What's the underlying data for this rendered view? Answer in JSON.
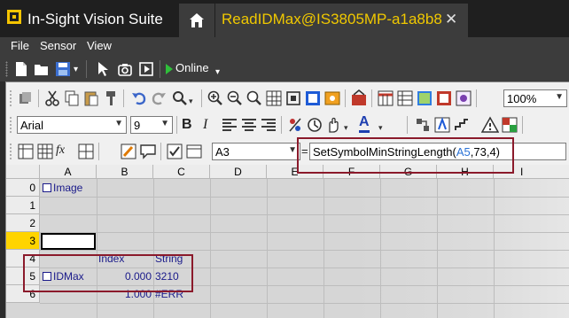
{
  "titlebar": {
    "app_title": "In-Sight Vision Suite",
    "active_tab": "ReadIDMax@IS3805MP-a1a8b8",
    "close_glyph": "✕"
  },
  "menu": {
    "items": [
      "File",
      "Sensor",
      "View"
    ]
  },
  "toolbar_top": {
    "online_label": "Online"
  },
  "toolbar_zoom": {
    "zoom_value": "100%"
  },
  "toolbar_font": {
    "font_name": "Arial",
    "font_size": "9"
  },
  "formula_bar": {
    "cell_ref": "A3",
    "equals": "=",
    "formula_prefix": "SetSymbolMinStringLength(",
    "formula_ref": "A5",
    "formula_suffix": ",73,4)"
  },
  "grid": {
    "columns": [
      "A",
      "B",
      "C",
      "D",
      "E",
      "F",
      "G",
      "H",
      "I"
    ],
    "rows": [
      "0",
      "1",
      "2",
      "3",
      "4",
      "5",
      "6"
    ],
    "selected_row": "3",
    "cells": {
      "a0": "Image",
      "b4": "Index",
      "c4": "String",
      "a5": "IDMax",
      "b5": "0.000",
      "c5": "3210",
      "b6": "1.000",
      "c6": "#ERR"
    }
  },
  "colors": {
    "accent_yellow": "#f0c800",
    "cell_text": "#1a1a8a",
    "highlight_border": "#8b1a2b",
    "selected_row_header": "#ffd400"
  }
}
